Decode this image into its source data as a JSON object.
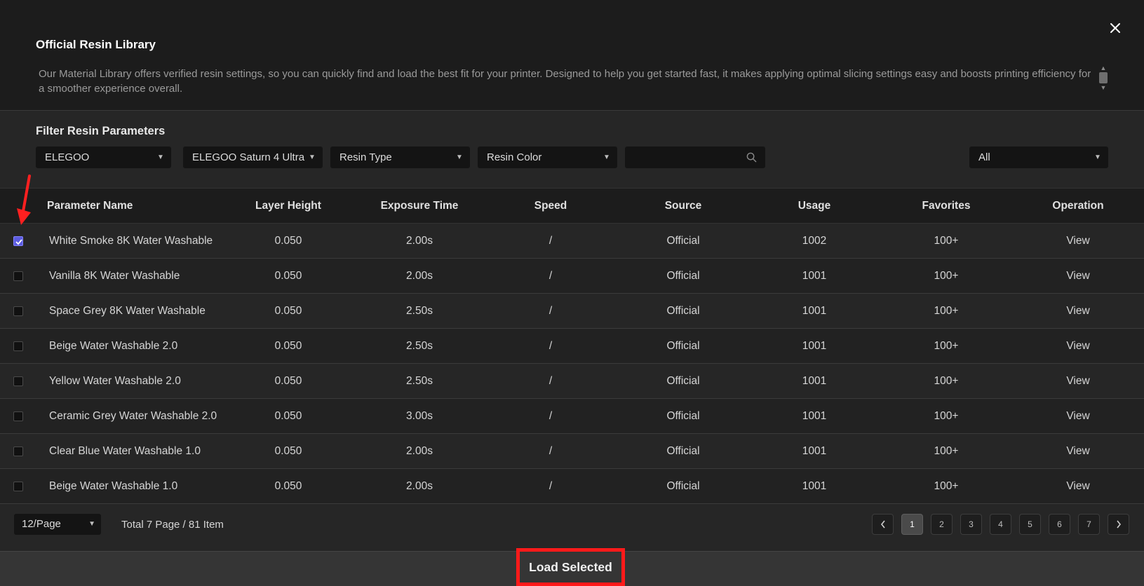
{
  "dialog": {
    "title": "Official Resin Library",
    "description": "Our Material Library offers verified resin settings, so you can quickly find and load the best fit for your printer. Designed to help you get started fast, it makes applying optimal slicing settings easy and boosts printing efficiency for a smoother experience overall.",
    "close_icon": "close-icon"
  },
  "filter": {
    "title": "Filter Resin Parameters",
    "brand": "ELEGOO",
    "printer": "ELEGOO Saturn 4 Ultra",
    "resin_type": "Resin Type",
    "resin_color": "Resin Color",
    "search_value": "",
    "scope": "All"
  },
  "table": {
    "headers": {
      "name": "Parameter Name",
      "layer_height": "Layer Height",
      "exposure": "Exposure Time",
      "speed": "Speed",
      "source": "Source",
      "usage": "Usage",
      "favorites": "Favorites",
      "operation": "Operation"
    },
    "rows": [
      {
        "checked": true,
        "name": "White Smoke 8K Water Washable",
        "layer_height": "0.050",
        "exposure": "2.00s",
        "speed": "/",
        "source": "Official",
        "usage": "1002",
        "favorites": "100+",
        "operation": "View"
      },
      {
        "checked": false,
        "name": "Vanilla 8K Water Washable",
        "layer_height": "0.050",
        "exposure": "2.00s",
        "speed": "/",
        "source": "Official",
        "usage": "1001",
        "favorites": "100+",
        "operation": "View"
      },
      {
        "checked": false,
        "name": "Space Grey 8K Water Washable",
        "layer_height": "0.050",
        "exposure": "2.50s",
        "speed": "/",
        "source": "Official",
        "usage": "1001",
        "favorites": "100+",
        "operation": "View"
      },
      {
        "checked": false,
        "name": "Beige Water Washable 2.0",
        "layer_height": "0.050",
        "exposure": "2.50s",
        "speed": "/",
        "source": "Official",
        "usage": "1001",
        "favorites": "100+",
        "operation": "View"
      },
      {
        "checked": false,
        "name": "Yellow Water Washable 2.0",
        "layer_height": "0.050",
        "exposure": "2.50s",
        "speed": "/",
        "source": "Official",
        "usage": "1001",
        "favorites": "100+",
        "operation": "View"
      },
      {
        "checked": false,
        "name": "Ceramic Grey Water Washable 2.0",
        "layer_height": "0.050",
        "exposure": "3.00s",
        "speed": "/",
        "source": "Official",
        "usage": "1001",
        "favorites": "100+",
        "operation": "View"
      },
      {
        "checked": false,
        "name": "Clear Blue Water Washable 1.0",
        "layer_height": "0.050",
        "exposure": "2.00s",
        "speed": "/",
        "source": "Official",
        "usage": "1001",
        "favorites": "100+",
        "operation": "View"
      },
      {
        "checked": false,
        "name": "Beige Water Washable 1.0",
        "layer_height": "0.050",
        "exposure": "2.00s",
        "speed": "/",
        "source": "Official",
        "usage": "1001",
        "favorites": "100+",
        "operation": "View"
      }
    ]
  },
  "pagination": {
    "page_size": "12/Page",
    "total": "Total 7 Page / 81 Item",
    "pages": [
      "1",
      "2",
      "3",
      "4",
      "5",
      "6",
      "7"
    ],
    "current": "1"
  },
  "footer": {
    "load_button": "Load Selected"
  },
  "colors": {
    "accent": "#5b5be0",
    "highlight_red": "#ff1a1a"
  }
}
